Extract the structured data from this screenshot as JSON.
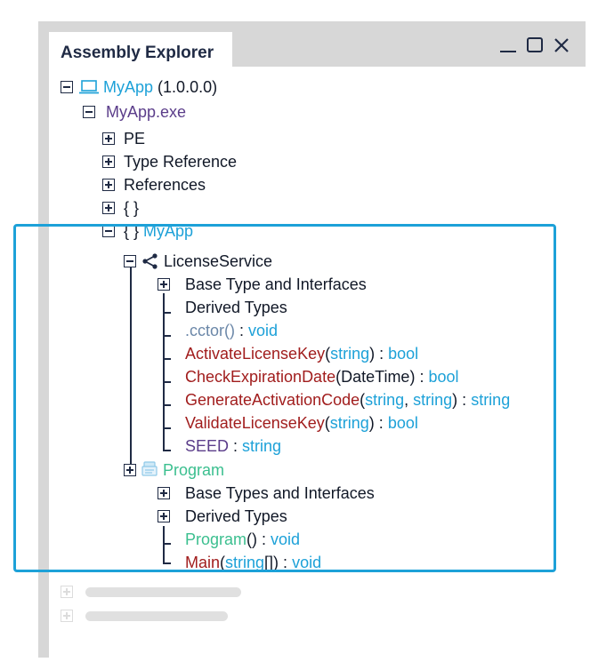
{
  "window": {
    "title": "Assembly Explorer",
    "controls": {
      "minimize": "minimize-icon",
      "maximize": "maximize-icon",
      "close": "close-icon"
    }
  },
  "tree": {
    "root": {
      "name": "MyApp",
      "version": "(1.0.0.0)",
      "icon": "laptop-icon"
    },
    "exe": {
      "name": "MyApp.exe"
    },
    "pe": "PE",
    "type_ref": "Type Reference",
    "references": "References",
    "empty_ns": "{ }",
    "ns": {
      "braces": "{ }",
      "name": "MyApp"
    },
    "license_service": {
      "name": "LicenseService",
      "icon": "class-share-icon",
      "base_types": "Base Type and Interfaces",
      "derived_types": "Derived Types",
      "members": {
        "cctor": {
          "name": ".cctor()",
          "sep": " : ",
          "ret": "void"
        },
        "activate": {
          "name": "ActivateLicenseKey",
          "open": "(",
          "p1": "string",
          "close": ")",
          "sep": " : ",
          "ret": "bool"
        },
        "check": {
          "name": "CheckExpirationDate",
          "open": "(",
          "p1": "DateTime",
          "close": ")",
          "sep": " : ",
          "ret": "bool"
        },
        "generate": {
          "name": "GenerateActivationCode",
          "open": "(",
          "p1": "string",
          "comma": ", ",
          "p2": "string",
          "close": ")",
          "sep": " : ",
          "ret": "string"
        },
        "validate": {
          "name": "ValidateLicenseKey",
          "open": "(",
          "p1": "string",
          "close": ")",
          "sep": " : ",
          "ret": "bool"
        },
        "seed": {
          "name": "SEED",
          "sep": " : ",
          "ret": "string"
        }
      }
    },
    "program": {
      "name": "Program",
      "icon": "program-class-icon",
      "base_types": "Base Types and Interfaces",
      "derived_types": "Derived Types",
      "members": {
        "ctor": {
          "name": "Program",
          "parens": "()",
          "sep": " : ",
          "ret": "void"
        },
        "main": {
          "name": "Main",
          "open": "(",
          "p1": "string",
          "arr": "[]",
          "close": ")",
          "sep": " : ",
          "ret": "void"
        }
      }
    }
  },
  "colors": {
    "accent": "#1da1d8",
    "namespace_purple": "#5b3d8a",
    "method_red": "#a11d1d",
    "class_green": "#3bbf8f"
  }
}
